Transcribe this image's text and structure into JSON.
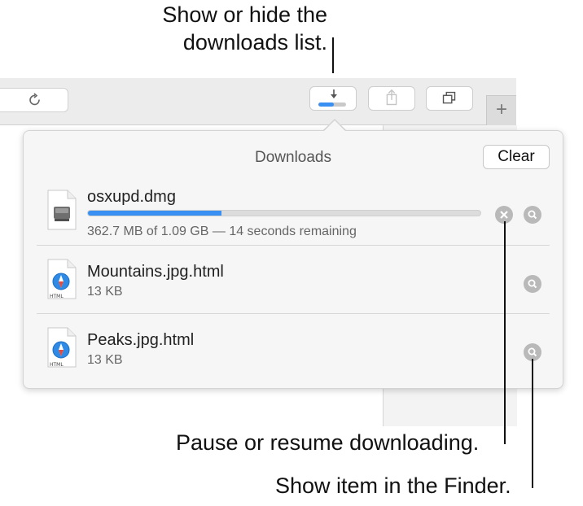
{
  "callouts": {
    "downloads_list_line1": "Show or hide the",
    "downloads_list_line2": "downloads list.",
    "pause_resume": "Pause or resume downloading.",
    "show_in_finder": "Show item in the Finder."
  },
  "toolbar": {
    "downloads_progress_percent": 55,
    "new_tab_label": "+"
  },
  "downloads": {
    "title": "Downloads",
    "clear_label": "Clear",
    "items": [
      {
        "name": "osxupd.dmg",
        "meta": "362.7 MB of 1.09 GB — 14 seconds remaining",
        "progress_percent": 34,
        "icon": "disk-image-icon"
      },
      {
        "name": "Mountains.jpg.html",
        "meta": "13 KB",
        "icon_label": "HTML",
        "icon": "safari-html-file-icon"
      },
      {
        "name": "Peaks.jpg.html",
        "meta": "13 KB",
        "icon_label": "HTML",
        "icon": "safari-html-file-icon"
      }
    ]
  },
  "colors": {
    "accent": "#3a8ff2",
    "popover_bg": "#f6f6f6",
    "toolbar_bg": "#ececec"
  }
}
